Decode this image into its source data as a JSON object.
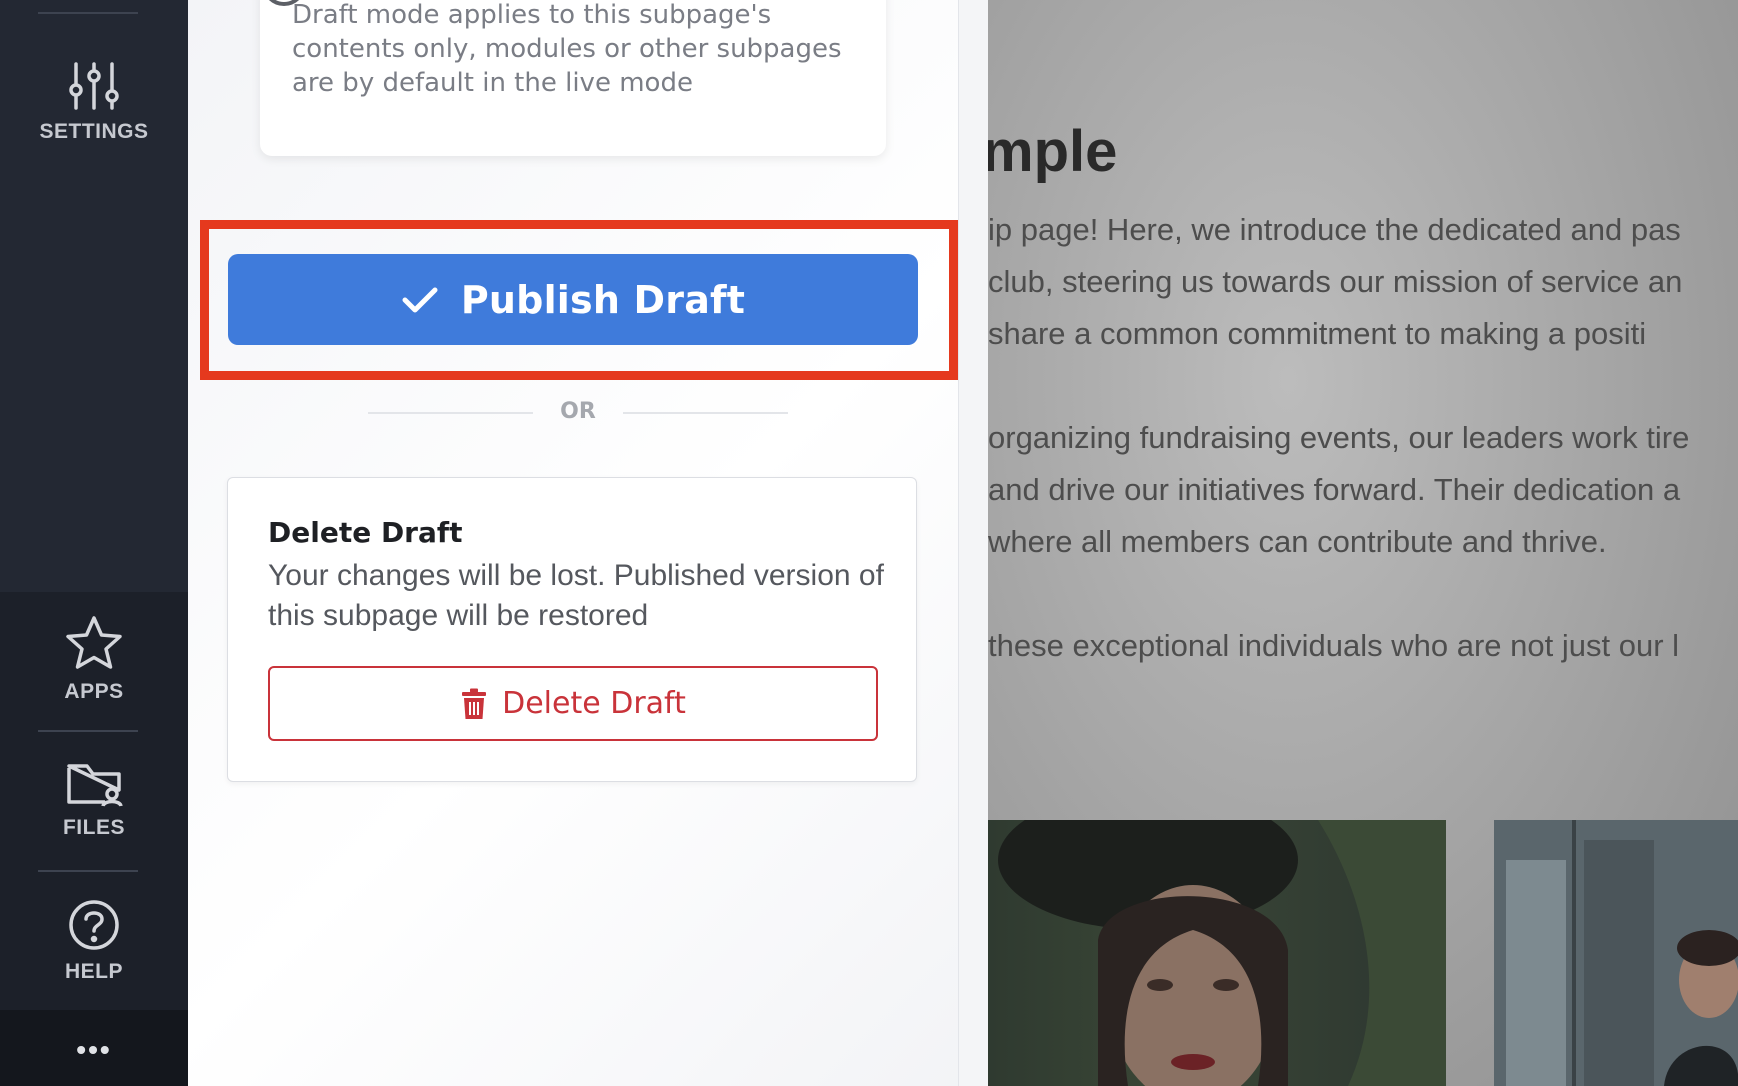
{
  "rail": {
    "items": [
      {
        "label": "SETTINGS",
        "icon": "sliders-icon"
      },
      {
        "label": "APPS",
        "icon": "star-icon"
      },
      {
        "label": "FILES",
        "icon": "folder-user-icon"
      },
      {
        "label": "HELP",
        "icon": "help-circle-icon"
      }
    ],
    "more": "•••"
  },
  "panel": {
    "info_text": "Draft mode applies to this subpage's contents only, modules or other subpages are by default in the live mode",
    "publish_label": "Publish Draft",
    "or_label": "OR",
    "delete_title": "Delete Draft",
    "delete_desc": "Your changes will be lost. Published version of this subpage will be restored",
    "delete_button_label": "Delete Draft"
  },
  "preview": {
    "heading": "mple",
    "paragraphs": [
      "ip page! Here, we introduce the dedicated and pas",
      "club, steering us towards our mission of service an",
      "share a common commitment to making a positi",
      "organizing fundraising events, our leaders work tire",
      "and drive our initiatives forward. Their dedication a",
      "where all members can contribute and thrive.",
      "these exceptional individuals who are not just our l"
    ]
  },
  "colors": {
    "accent": "#3f7bdb",
    "highlight": "#e5391e",
    "danger": "#c9333a",
    "rail": "#232833"
  }
}
